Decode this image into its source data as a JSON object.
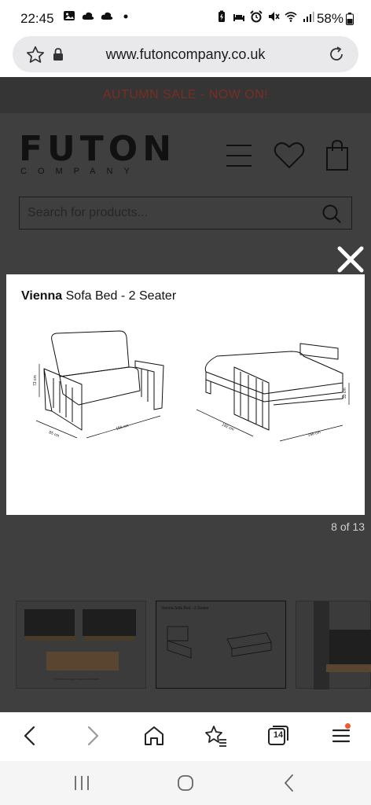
{
  "status": {
    "time": "22:45",
    "battery": "58%",
    "left_icons": [
      "image-icon",
      "cloud-icon",
      "cloud-icon",
      "dot-icon"
    ],
    "right_icons": [
      "battery-saver-icon",
      "sleep-icon",
      "alarm-icon",
      "mute-icon",
      "wifi-icon",
      "signal-icon"
    ]
  },
  "browser": {
    "url": "www.futoncompany.co.uk",
    "tabs_count": "14"
  },
  "site": {
    "promo": "AUTUMN SALE - NOW ON!",
    "logo_word": "FUTON",
    "logo_sub": "COMPANY",
    "search_placeholder": "Search for products..."
  },
  "lightbox": {
    "title_bold": "Vienna",
    "title_rest": " Sofa Bed - 2 Seater",
    "counter": "8 of 13",
    "dims": {
      "height_sofa": "73 cm",
      "depth_sofa": "85 cm",
      "width_sofa": "156 cm",
      "length_bed": "192 cm",
      "width_bed": "156 cm",
      "height_bed": "33 cm"
    }
  },
  "thumbnails": {
    "thumb2_caption": "Vienna Sofa Bed - 2 Seater",
    "thumb1_caption": "Vienna storage drawer available"
  },
  "colors": {
    "promo_text": "#7a2e22",
    "overlay": "#3f3f3f",
    "accent_dot": "#f05a28"
  }
}
